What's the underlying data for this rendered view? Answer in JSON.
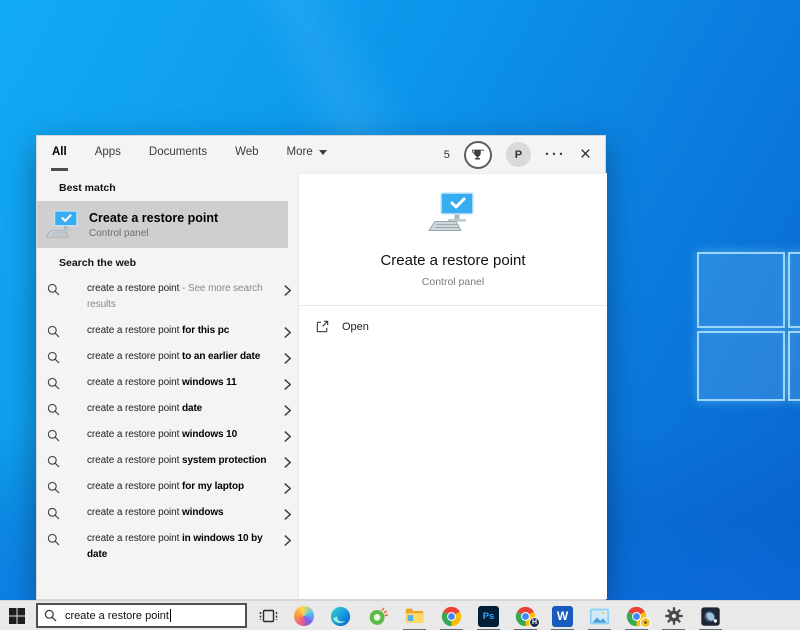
{
  "colors": {
    "accent": "#0078d7",
    "wallpaper_top": "#12aaf5",
    "wallpaper_bottom": "#0a64cd",
    "taskbar_bg": "#e9e9e9",
    "best_match_highlight": "#cfcfcf"
  },
  "search_window": {
    "tabs": [
      {
        "label": "All",
        "active": true
      },
      {
        "label": "Apps",
        "active": false
      },
      {
        "label": "Documents",
        "active": false
      },
      {
        "label": "Web",
        "active": false
      },
      {
        "label": "More",
        "active": false,
        "dropdown": true
      }
    ],
    "header": {
      "rewards_count": "5",
      "avatar_initial": "P",
      "more_glyph": "···",
      "close_glyph": "×"
    },
    "sections": {
      "best_match": "Best match",
      "web": "Search the web"
    },
    "best_match": {
      "title": "Create a restore point",
      "subtitle": "Control panel",
      "icon": "monitor-check-icon"
    },
    "suggestions": [
      {
        "prefix": "create a restore point",
        "bold": "",
        "note": " - See more search results"
      },
      {
        "prefix": "create a restore point ",
        "bold": "for this pc"
      },
      {
        "prefix": "create a restore point ",
        "bold": "to an earlier date"
      },
      {
        "prefix": "create a restore point ",
        "bold": "windows 11"
      },
      {
        "prefix": "create a restore point ",
        "bold": "date"
      },
      {
        "prefix": "create a restore point ",
        "bold": "windows 10"
      },
      {
        "prefix": "create a restore point ",
        "bold": "system protection"
      },
      {
        "prefix": "create a restore point ",
        "bold": "for my laptop"
      },
      {
        "prefix": "create a restore point ",
        "bold": "windows"
      },
      {
        "prefix": "create a restore point ",
        "bold": "in windows 10 by date"
      }
    ],
    "preview": {
      "title": "Create a restore point",
      "subtitle": "Control panel",
      "open_label": "Open",
      "icon": "monitor-check-icon"
    }
  },
  "taskbar": {
    "search_value": "create a restore point",
    "photoshop_label": "Ps",
    "word_label": "W",
    "chrome_badge_letter": "H",
    "icons": [
      {
        "name": "copilot",
        "running": false
      },
      {
        "name": "edge",
        "running": false
      },
      {
        "name": "driver-updater",
        "running": false
      },
      {
        "name": "file-explorer",
        "running": true
      },
      {
        "name": "chrome",
        "running": true
      },
      {
        "name": "photoshop",
        "running": true
      },
      {
        "name": "chrome-profile-h",
        "running": true
      },
      {
        "name": "word",
        "running": true
      },
      {
        "name": "photos",
        "running": true
      },
      {
        "name": "chrome-profile-gold",
        "running": true
      },
      {
        "name": "settings",
        "running": true
      },
      {
        "name": "game",
        "running": true
      }
    ]
  }
}
